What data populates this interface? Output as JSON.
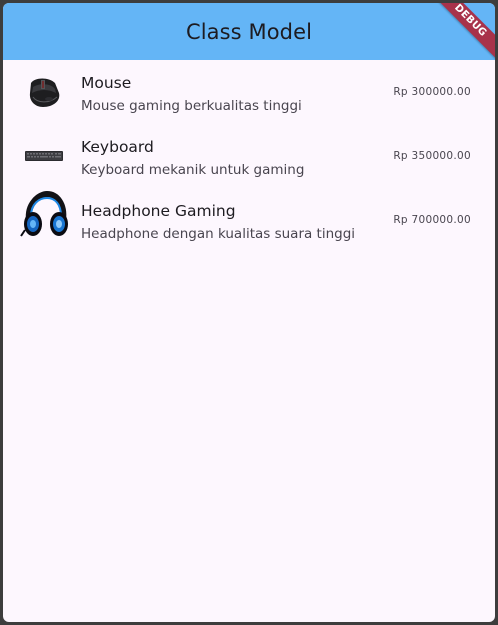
{
  "appbar": {
    "title": "Class Model",
    "debug_label": "DEBUG"
  },
  "items": [
    {
      "title": "Mouse",
      "subtitle": "Mouse gaming berkualitas tinggi",
      "price": "Rp 300000.00",
      "icon": "mouse-icon"
    },
    {
      "title": "Keyboard",
      "subtitle": "Keyboard mekanik untuk gaming",
      "price": "Rp 350000.00",
      "icon": "keyboard-icon"
    },
    {
      "title": "Headphone Gaming",
      "subtitle": "Headphone dengan kualitas suara tinggi",
      "price": "Rp 700000.00",
      "icon": "headphone-icon"
    }
  ],
  "colors": {
    "appbar": "#64b5f6",
    "background": "#fdf7fe",
    "debug_ribbon": "#a8324a"
  }
}
